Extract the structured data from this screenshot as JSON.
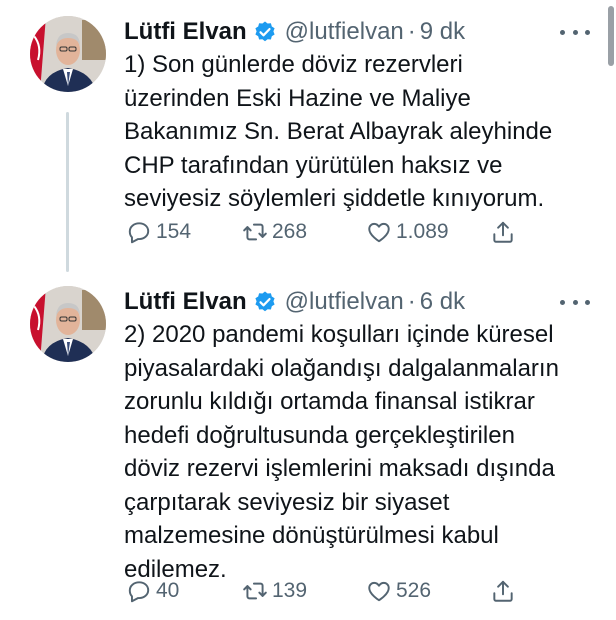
{
  "colors": {
    "text": "#0f1419",
    "muted": "#536471",
    "verified": "#1d9bf0",
    "thread_line": "#cfd9de"
  },
  "tweets": [
    {
      "name": "Lütfi Elvan",
      "handle": "@lutfielvan",
      "separator": "·",
      "time": "9 dk",
      "lines": [
        "1) Son günlerde döviz rezervleri",
        "üzerinden Eski Hazine ve Maliye",
        "Bakanımız Sn. Berat Albayrak aleyhinde",
        "CHP tarafından yürütülen haksız ve",
        "seviyesiz söylemleri şiddetle kınıyorum."
      ],
      "replies": "154",
      "retweets": "268",
      "likes": "1.089",
      "icons": [
        "reply-icon",
        "retweet-icon",
        "like-icon",
        "share-icon"
      ]
    },
    {
      "name": "Lütfi Elvan",
      "handle": "@lutfielvan",
      "separator": "·",
      "time": "6 dk",
      "lines": [
        "2) 2020 pandemi koşulları içinde küresel",
        "piyasalardaki olağandışı dalgalanmaların",
        "zorunlu kıldığı ortamda finansal istikrar",
        "hedefi doğrultusunda gerçekleştirilen",
        "döviz rezervi işlemlerini maksadı dışında",
        "çarpıtarak seviyesiz bir siyaset",
        "malzemesine dönüştürülmesi  kabul",
        "edilemez."
      ],
      "replies": "40",
      "retweets": "139",
      "likes": "526",
      "icons": [
        "reply-icon",
        "retweet-icon",
        "like-icon",
        "share-icon"
      ]
    }
  ]
}
